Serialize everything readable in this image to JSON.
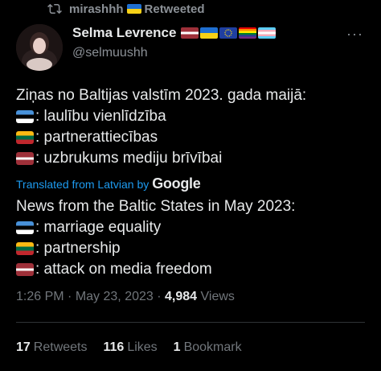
{
  "retweet": {
    "user": "mirashhh",
    "label": "Retweeted",
    "icon": "retweet-icon"
  },
  "author": {
    "display_name": "Selma Levrence",
    "handle": "@selmuushh",
    "name_flags": [
      "latvia-flag",
      "ukraine-flag",
      "eu-flag",
      "rainbow-flag",
      "transgender-flag"
    ]
  },
  "tweet": {
    "original": {
      "title": "Ziņas no Baltijas valstīm 2023. gada maijā:",
      "lines": [
        {
          "flag": "estonia-flag",
          "text": ": laulību vienlīdzība"
        },
        {
          "flag": "lithuania-flag",
          "text": ": partnerattiecības"
        },
        {
          "flag": "latvia-flag",
          "text": ": uzbrukums mediju brīvībai"
        }
      ]
    },
    "translation_label": "Translated from Latvian by",
    "translation_provider": "Google",
    "translated": {
      "title": "News from the Baltic States in May 2023:",
      "lines": [
        {
          "flag": "estonia-flag",
          "text": " : marriage equality"
        },
        {
          "flag": "lithuania-flag",
          "text": " : partnership"
        },
        {
          "flag": "latvia-flag",
          "text": " : attack on media freedom"
        }
      ]
    }
  },
  "meta": {
    "time": "1:26 PM",
    "date": "May 23, 2023",
    "views_count": "4,984",
    "views_label": "Views"
  },
  "stats": {
    "retweets_count": "17",
    "retweets_label": "Retweets",
    "likes_count": "116",
    "likes_label": "Likes",
    "bookmarks_count": "1",
    "bookmarks_label": "Bookmark"
  },
  "colors": {
    "background": "#000000",
    "text": "#e7e9ea",
    "secondary": "#71767b",
    "link": "#1d9bf0"
  }
}
